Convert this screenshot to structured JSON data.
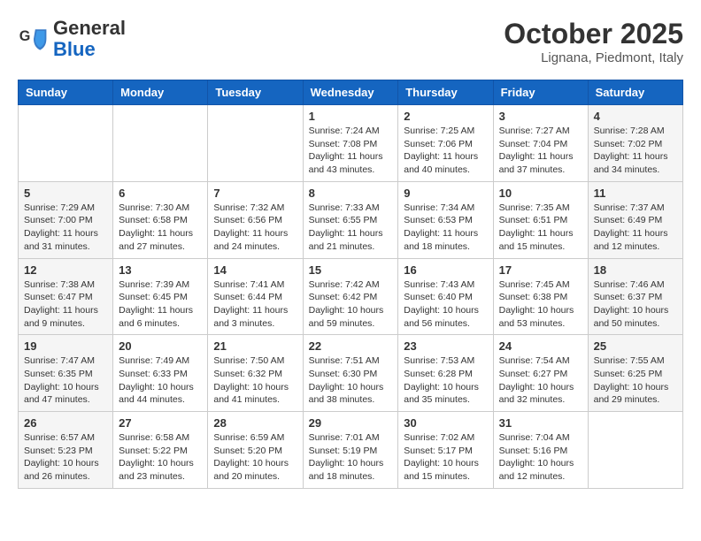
{
  "header": {
    "logo_general": "General",
    "logo_blue": "Blue",
    "month_title": "October 2025",
    "location": "Lignana, Piedmont, Italy"
  },
  "weekdays": [
    "Sunday",
    "Monday",
    "Tuesday",
    "Wednesday",
    "Thursday",
    "Friday",
    "Saturday"
  ],
  "weeks": [
    [
      {
        "day": "",
        "info": ""
      },
      {
        "day": "",
        "info": ""
      },
      {
        "day": "",
        "info": ""
      },
      {
        "day": "1",
        "info": "Sunrise: 7:24 AM\nSunset: 7:08 PM\nDaylight: 11 hours and 43 minutes."
      },
      {
        "day": "2",
        "info": "Sunrise: 7:25 AM\nSunset: 7:06 PM\nDaylight: 11 hours and 40 minutes."
      },
      {
        "day": "3",
        "info": "Sunrise: 7:27 AM\nSunset: 7:04 PM\nDaylight: 11 hours and 37 minutes."
      },
      {
        "day": "4",
        "info": "Sunrise: 7:28 AM\nSunset: 7:02 PM\nDaylight: 11 hours and 34 minutes."
      }
    ],
    [
      {
        "day": "5",
        "info": "Sunrise: 7:29 AM\nSunset: 7:00 PM\nDaylight: 11 hours and 31 minutes."
      },
      {
        "day": "6",
        "info": "Sunrise: 7:30 AM\nSunset: 6:58 PM\nDaylight: 11 hours and 27 minutes."
      },
      {
        "day": "7",
        "info": "Sunrise: 7:32 AM\nSunset: 6:56 PM\nDaylight: 11 hours and 24 minutes."
      },
      {
        "day": "8",
        "info": "Sunrise: 7:33 AM\nSunset: 6:55 PM\nDaylight: 11 hours and 21 minutes."
      },
      {
        "day": "9",
        "info": "Sunrise: 7:34 AM\nSunset: 6:53 PM\nDaylight: 11 hours and 18 minutes."
      },
      {
        "day": "10",
        "info": "Sunrise: 7:35 AM\nSunset: 6:51 PM\nDaylight: 11 hours and 15 minutes."
      },
      {
        "day": "11",
        "info": "Sunrise: 7:37 AM\nSunset: 6:49 PM\nDaylight: 11 hours and 12 minutes."
      }
    ],
    [
      {
        "day": "12",
        "info": "Sunrise: 7:38 AM\nSunset: 6:47 PM\nDaylight: 11 hours and 9 minutes."
      },
      {
        "day": "13",
        "info": "Sunrise: 7:39 AM\nSunset: 6:45 PM\nDaylight: 11 hours and 6 minutes."
      },
      {
        "day": "14",
        "info": "Sunrise: 7:41 AM\nSunset: 6:44 PM\nDaylight: 11 hours and 3 minutes."
      },
      {
        "day": "15",
        "info": "Sunrise: 7:42 AM\nSunset: 6:42 PM\nDaylight: 10 hours and 59 minutes."
      },
      {
        "day": "16",
        "info": "Sunrise: 7:43 AM\nSunset: 6:40 PM\nDaylight: 10 hours and 56 minutes."
      },
      {
        "day": "17",
        "info": "Sunrise: 7:45 AM\nSunset: 6:38 PM\nDaylight: 10 hours and 53 minutes."
      },
      {
        "day": "18",
        "info": "Sunrise: 7:46 AM\nSunset: 6:37 PM\nDaylight: 10 hours and 50 minutes."
      }
    ],
    [
      {
        "day": "19",
        "info": "Sunrise: 7:47 AM\nSunset: 6:35 PM\nDaylight: 10 hours and 47 minutes."
      },
      {
        "day": "20",
        "info": "Sunrise: 7:49 AM\nSunset: 6:33 PM\nDaylight: 10 hours and 44 minutes."
      },
      {
        "day": "21",
        "info": "Sunrise: 7:50 AM\nSunset: 6:32 PM\nDaylight: 10 hours and 41 minutes."
      },
      {
        "day": "22",
        "info": "Sunrise: 7:51 AM\nSunset: 6:30 PM\nDaylight: 10 hours and 38 minutes."
      },
      {
        "day": "23",
        "info": "Sunrise: 7:53 AM\nSunset: 6:28 PM\nDaylight: 10 hours and 35 minutes."
      },
      {
        "day": "24",
        "info": "Sunrise: 7:54 AM\nSunset: 6:27 PM\nDaylight: 10 hours and 32 minutes."
      },
      {
        "day": "25",
        "info": "Sunrise: 7:55 AM\nSunset: 6:25 PM\nDaylight: 10 hours and 29 minutes."
      }
    ],
    [
      {
        "day": "26",
        "info": "Sunrise: 6:57 AM\nSunset: 5:23 PM\nDaylight: 10 hours and 26 minutes."
      },
      {
        "day": "27",
        "info": "Sunrise: 6:58 AM\nSunset: 5:22 PM\nDaylight: 10 hours and 23 minutes."
      },
      {
        "day": "28",
        "info": "Sunrise: 6:59 AM\nSunset: 5:20 PM\nDaylight: 10 hours and 20 minutes."
      },
      {
        "day": "29",
        "info": "Sunrise: 7:01 AM\nSunset: 5:19 PM\nDaylight: 10 hours and 18 minutes."
      },
      {
        "day": "30",
        "info": "Sunrise: 7:02 AM\nSunset: 5:17 PM\nDaylight: 10 hours and 15 minutes."
      },
      {
        "day": "31",
        "info": "Sunrise: 7:04 AM\nSunset: 5:16 PM\nDaylight: 10 hours and 12 minutes."
      },
      {
        "day": "",
        "info": ""
      }
    ]
  ]
}
